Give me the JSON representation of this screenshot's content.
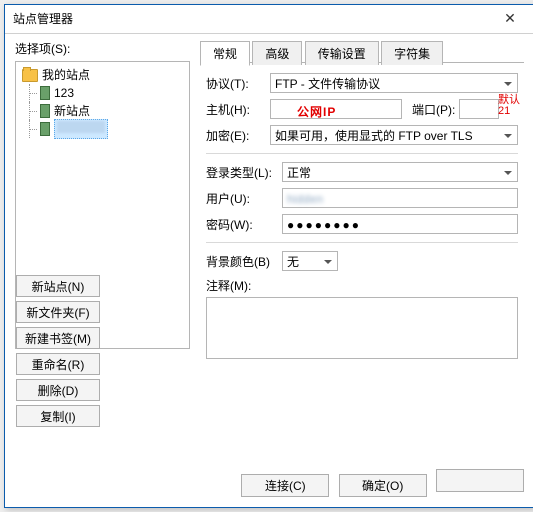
{
  "window": {
    "title": "站点管理器"
  },
  "left": {
    "select_label": "选择项(S):",
    "tree": {
      "root": "我的站点",
      "items": [
        "123",
        "新站点",
        ""
      ]
    },
    "buttons": {
      "new_site": "新站点(N)",
      "new_folder": "新文件夹(F)",
      "new_bookmark": "新建书签(M)",
      "rename": "重命名(R)",
      "delete": "删除(D)",
      "copy": "复制(I)"
    }
  },
  "tabs": {
    "general": "常规",
    "advanced": "高级",
    "transfer": "传输设置",
    "charset": "字符集"
  },
  "form": {
    "protocol_label": "协议(T):",
    "protocol_value": "FTP - 文件传输协议",
    "host_label": "主机(H):",
    "host_overlay": "公网IP",
    "port_label": "端口(P):",
    "port_annotation": "默认21",
    "encryption_label": "加密(E):",
    "encryption_value": "如果可用，使用显式的 FTP over TLS",
    "logon_type_label": "登录类型(L):",
    "logon_type_value": "正常",
    "user_label": "用户(U):",
    "user_value": "",
    "password_label": "密码(W):",
    "password_value": "●●●●●●●●",
    "bgcolor_label": "背景颜色(B)",
    "bgcolor_value": "无",
    "comment_label": "注释(M):"
  },
  "footer": {
    "connect": "连接(C)",
    "ok": "确定(O)",
    "cancel": ""
  }
}
